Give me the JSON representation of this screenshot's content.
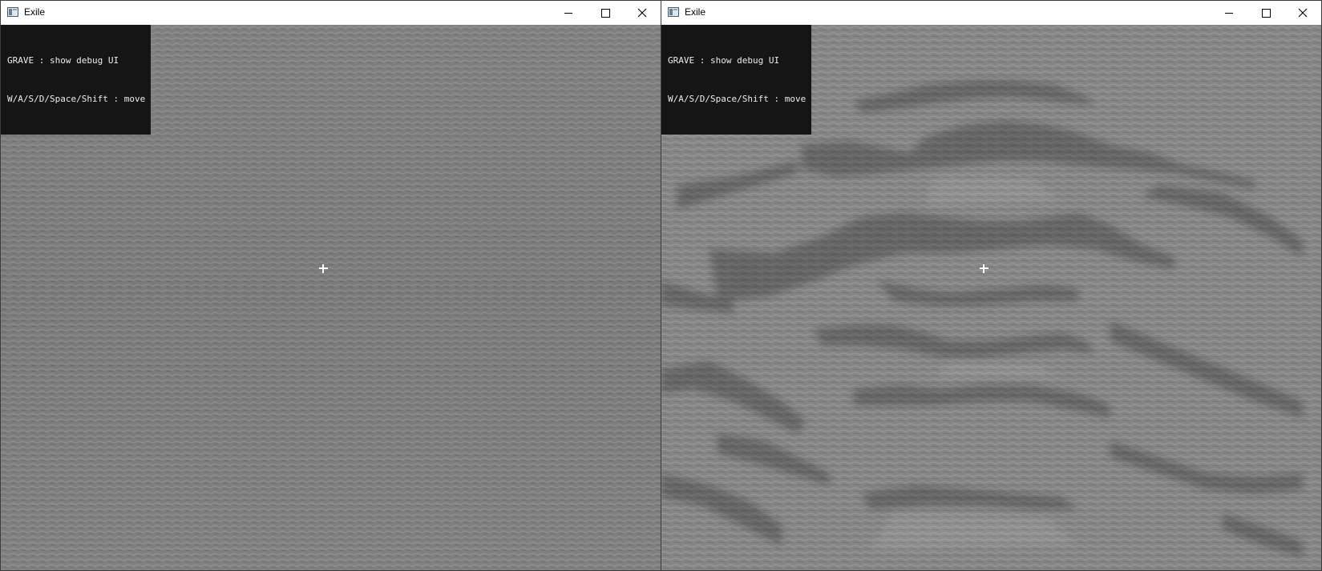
{
  "windows": [
    {
      "title": "Exile",
      "hud": {
        "line1": "GRAVE : show debug UI",
        "line2": "W/A/S/D/Space/Shift : move"
      },
      "scene": "flat stone floor viewed from above"
    },
    {
      "title": "Exile",
      "hud": {
        "line1": "GRAVE : show debug UI",
        "line2": "W/A/S/D/Space/Shift : move"
      },
      "scene": "stepped stone terrain with shadowed ledges"
    }
  ],
  "colors": {
    "stone": "#7e7e7e",
    "stone_light": "#8e8e8e",
    "stone_dark": "#6c6c6c",
    "shadow": "#5a5a5a",
    "hud_bg": "#151515",
    "hud_text": "#ececec",
    "titlebar": "#ffffff"
  },
  "icons": {
    "app": "app-window-icon",
    "minimize": "minimize-icon",
    "maximize": "maximize-icon",
    "close": "close-icon",
    "crosshair": "crosshair-icon"
  }
}
